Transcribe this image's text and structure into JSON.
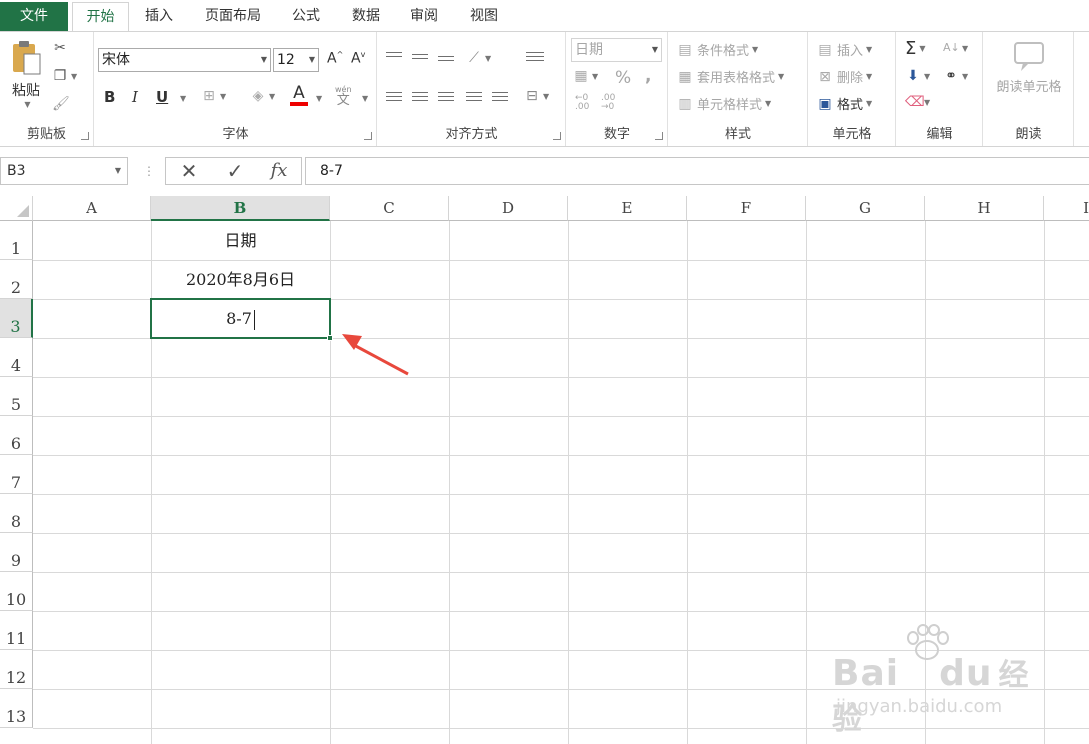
{
  "tabs": [
    {
      "label": "文件"
    },
    {
      "label": "开始"
    },
    {
      "label": "插入"
    },
    {
      "label": "页面布局"
    },
    {
      "label": "公式"
    },
    {
      "label": "数据"
    },
    {
      "label": "审阅"
    },
    {
      "label": "视图"
    }
  ],
  "ribbon": {
    "clipboard": {
      "label": "剪贴板",
      "paste": "粘贴"
    },
    "font": {
      "label": "字体",
      "name": "宋体",
      "size": "12",
      "bold": "B",
      "italic": "I",
      "underline": "U",
      "color_glyph": "A",
      "wen": "wén",
      "wen_char": "文"
    },
    "align": {
      "label": "对齐方式"
    },
    "number": {
      "label": "数字",
      "format": "日期",
      "percent": "%",
      "comma": ","
    },
    "styles": {
      "label": "样式",
      "cond": "条件格式",
      "table": "套用表格格式",
      "cell": "单元格样式"
    },
    "cells": {
      "label": "单元格",
      "insert": "插入",
      "delete": "删除",
      "format": "格式"
    },
    "editing": {
      "label": "编辑"
    },
    "read": {
      "label": "朗读",
      "readcells": "朗读单元格"
    }
  },
  "formula_bar": {
    "name_box": "B3",
    "fx": "fx",
    "value": "8-7"
  },
  "grid": {
    "columns": [
      "A",
      "B",
      "C",
      "D",
      "E",
      "F",
      "G",
      "H",
      "I"
    ],
    "rows": [
      "1",
      "2",
      "3",
      "4",
      "5",
      "6",
      "7",
      "8",
      "9",
      "10",
      "11",
      "12",
      "13"
    ],
    "cells": {
      "B1": "日期",
      "B2": "2020年8月6日",
      "B3": "8-7"
    },
    "active_cell": "B3"
  },
  "watermark": {
    "brand": "Bai",
    "brand2": "du",
    "brand_cn": "经验",
    "url": "jingyan.baidu.com"
  },
  "colors": {
    "accent": "#217346",
    "arrow": "#e8483c"
  }
}
